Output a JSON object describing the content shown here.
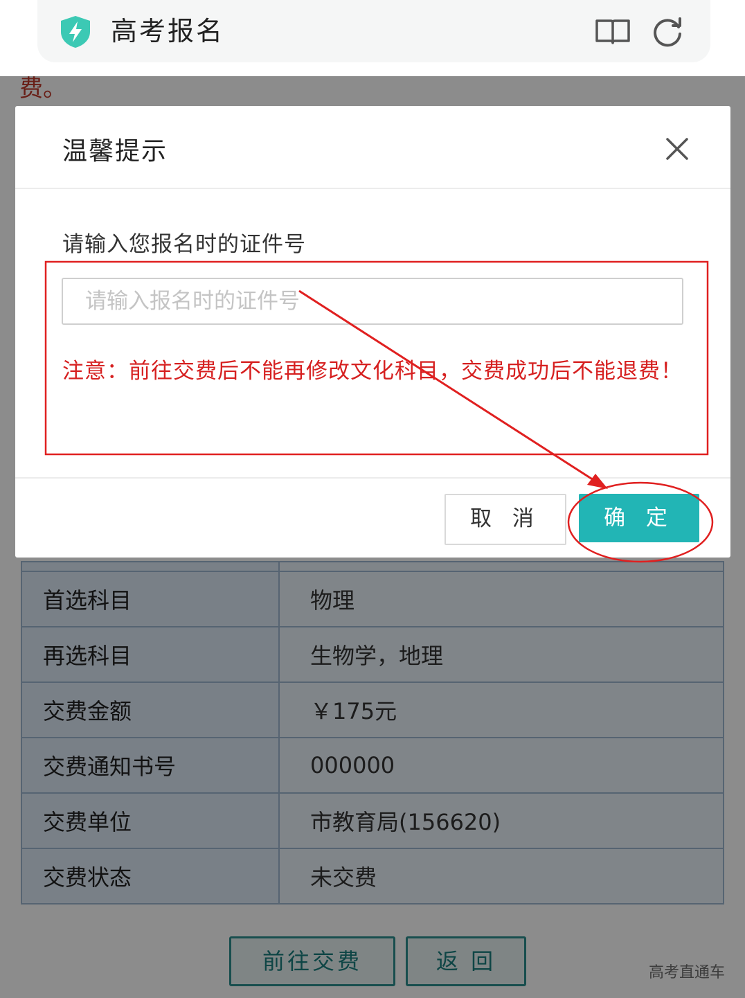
{
  "app_bar": {
    "title": "高考报名",
    "icons": [
      "shield-bolt-icon",
      "book-icon",
      "refresh-icon"
    ],
    "accent": "#3cc9b4"
  },
  "background_page": {
    "notice_tail": "费。",
    "table": [
      {
        "label": "首选科目",
        "value": "物理"
      },
      {
        "label": "再选科目",
        "value": "生物学，地理"
      },
      {
        "label": "交费金额",
        "value": "￥175元"
      },
      {
        "label": "交费通知书号",
        "value": "000000"
      },
      {
        "label": "交费单位",
        "value": "市教育局(156620)"
      },
      {
        "label": "交费状态",
        "value": "未交费"
      }
    ],
    "buttons": {
      "pay": "前往交费",
      "back": "返 回"
    },
    "watermark": "高考直通车"
  },
  "modal": {
    "title": "温馨提示",
    "field_label": "请输入您报名时的证件号",
    "input_value": "",
    "input_placeholder": "请输入报名时的证件号",
    "warning": "注意：前往交费后不能再修改文化科目，交费成功后不能退费！",
    "cancel_label": "取 消",
    "ok_label": "确 定",
    "primary_color": "#22b5b5",
    "warning_color": "#d62020"
  },
  "annotation": {
    "color": "#e02020",
    "marks": [
      "highlight-box",
      "arrow",
      "circle"
    ]
  }
}
